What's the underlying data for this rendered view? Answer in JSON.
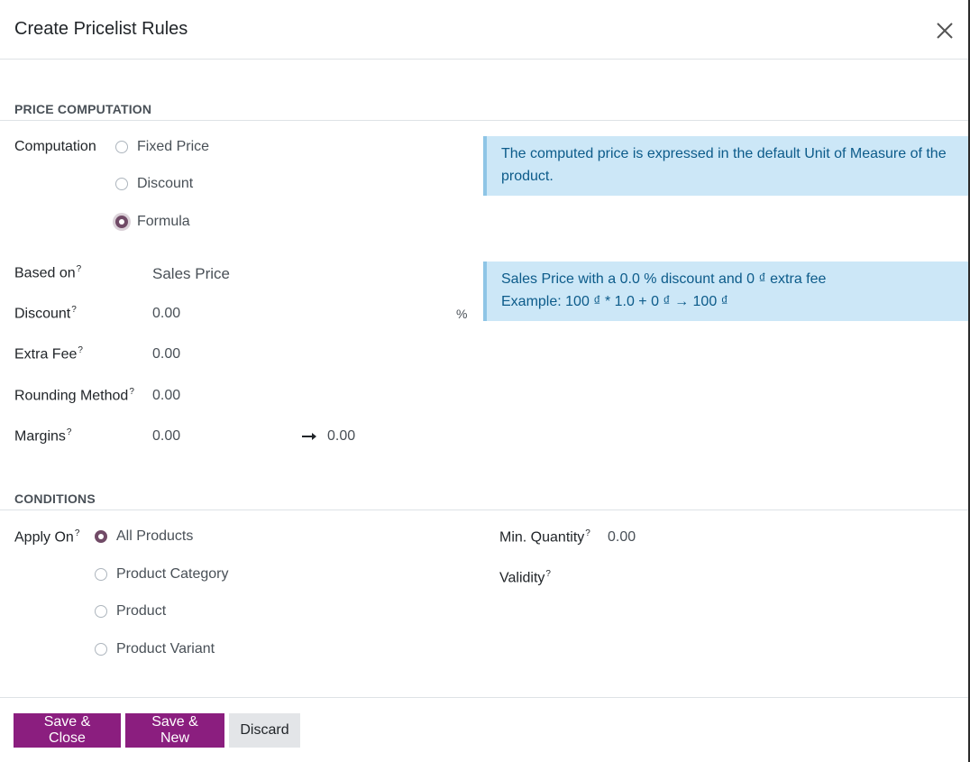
{
  "dialog": {
    "title": "Create Pricelist Rules"
  },
  "price_computation": {
    "section_title": "PRICE COMPUTATION",
    "computation_label": "Computation",
    "computation_options": [
      "Fixed Price",
      "Discount",
      "Formula"
    ],
    "computation_selected": "Formula",
    "info_uom": "The computed price is expressed in the default Unit of Measure of the product.",
    "based_on_label": "Based on",
    "based_on_value": "Sales Price",
    "discount_label": "Discount",
    "discount_value": "0.00",
    "discount_unit": "%",
    "extra_fee_label": "Extra Fee",
    "extra_fee_value": "0.00",
    "rounding_label": "Rounding Method",
    "rounding_value": "0.00",
    "margins_label": "Margins",
    "margins_min": "0.00",
    "margins_max": "0.00",
    "formula_info_line1": "Sales Price with a 0.0 % discount and 0 ₫ extra fee",
    "formula_info_line2": "Example: 100 ₫ * 1.0 + 0 ₫ → 100 ₫",
    "help_marker": "?"
  },
  "conditions": {
    "section_title": "CONDITIONS",
    "apply_on_label": "Apply On",
    "apply_on_options": [
      "All Products",
      "Product Category",
      "Product",
      "Product Variant"
    ],
    "apply_on_selected": "All Products",
    "min_quantity_label": "Min. Quantity",
    "min_quantity_value": "0.00",
    "validity_label": "Validity"
  },
  "footer": {
    "save_close_label": "Save & Close",
    "save_new_label": "Save & New",
    "discard_label": "Discard"
  },
  "colors": {
    "primary": "#8b1e7f",
    "radio_checked": "#714b67",
    "info_bg": "#cce7f7",
    "info_text": "#0c5b8a"
  }
}
